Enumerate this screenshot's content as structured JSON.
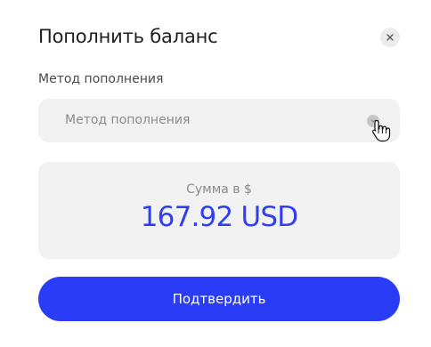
{
  "modal": {
    "title": "Пополнить баланс",
    "close_icon": "close-icon"
  },
  "method": {
    "label": "Метод пополнения",
    "value": "Метод пополнения",
    "arrow_icon": "chevron-down-icon"
  },
  "amount": {
    "label": "Сумма в $",
    "value": "167.92 USD"
  },
  "confirm": {
    "label": "Подтвердить"
  },
  "colors": {
    "accent": "#2b3cf7",
    "amount_text": "#2e3ff5",
    "field_background": "#f2f2f2"
  },
  "cursor_icon": "hand-pointer-icon"
}
